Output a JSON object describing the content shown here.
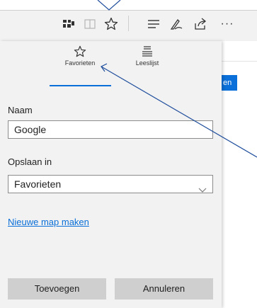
{
  "toolbar": {
    "icons": [
      "reading-view-icon",
      "book-icon",
      "favorite-star-icon",
      "hub-icon",
      "web-note-icon",
      "share-icon",
      "more-icon"
    ],
    "more_label": "···"
  },
  "panel": {
    "tabs": [
      {
        "label": "Favorieten",
        "icon": "star-outline-icon",
        "selected": true
      },
      {
        "label": "Leeslijst",
        "icon": "reading-list-icon",
        "selected": false
      }
    ],
    "name_label": "Naam",
    "name_value": "Google",
    "save_in_label": "Opslaan in",
    "save_in_value": "Favorieten",
    "new_folder_link": "Nieuwe map maken",
    "add_button": "Toevoegen",
    "cancel_button": "Annuleren"
  },
  "page": {
    "button_fragment": "en"
  },
  "colors": {
    "accent": "#0a6fd8",
    "panel_bg": "#f2f2f2",
    "button_bg": "#cfcfcf",
    "annotation_line": "#1f4e9c"
  }
}
